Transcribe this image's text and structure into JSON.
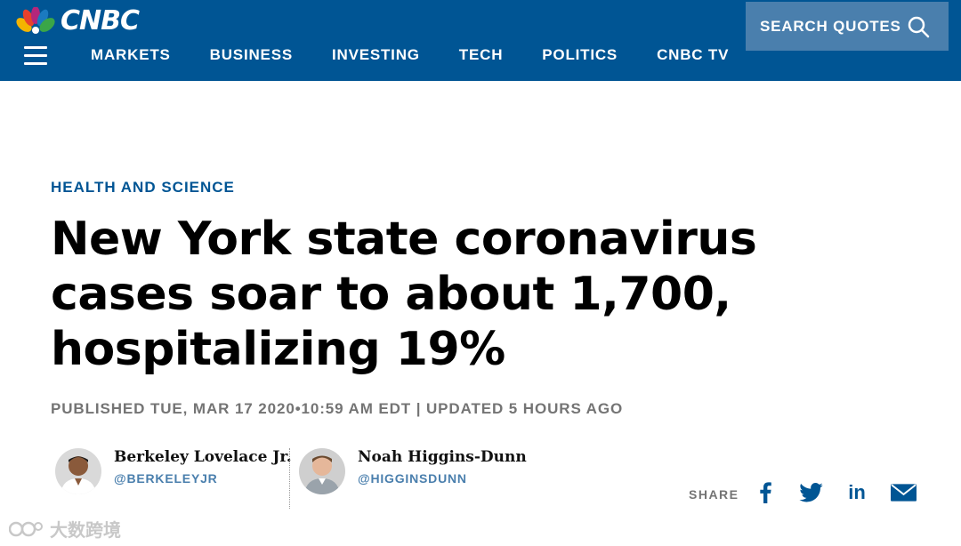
{
  "header": {
    "logo_text": "CNBC",
    "nav": [
      "MARKETS",
      "BUSINESS",
      "INVESTING",
      "TECH",
      "POLITICS",
      "CNBC TV"
    ],
    "search_label": "SEARCH QUOTES"
  },
  "article": {
    "section": "HEALTH AND SCIENCE",
    "headline": "New York state coronavirus cases soar to about 1,700, hospitalizing 19%",
    "timestamp": "PUBLISHED TUE, MAR 17 2020•10:59 AM EDT | UPDATED 5 HOURS AGO"
  },
  "authors": [
    {
      "name": "Berkeley Lovelace Jr.",
      "handle": "@BERKELEYJR"
    },
    {
      "name": "Noah Higgins-Dunn",
      "handle": "@HIGGINSDUNN"
    }
  ],
  "share": {
    "label": "SHARE",
    "linkedin_text": "in"
  },
  "watermark": {
    "text": "大数跨境"
  },
  "colors": {
    "brand": "#005594",
    "search_bg": "#4a7fad",
    "meta_gray": "#747474"
  }
}
